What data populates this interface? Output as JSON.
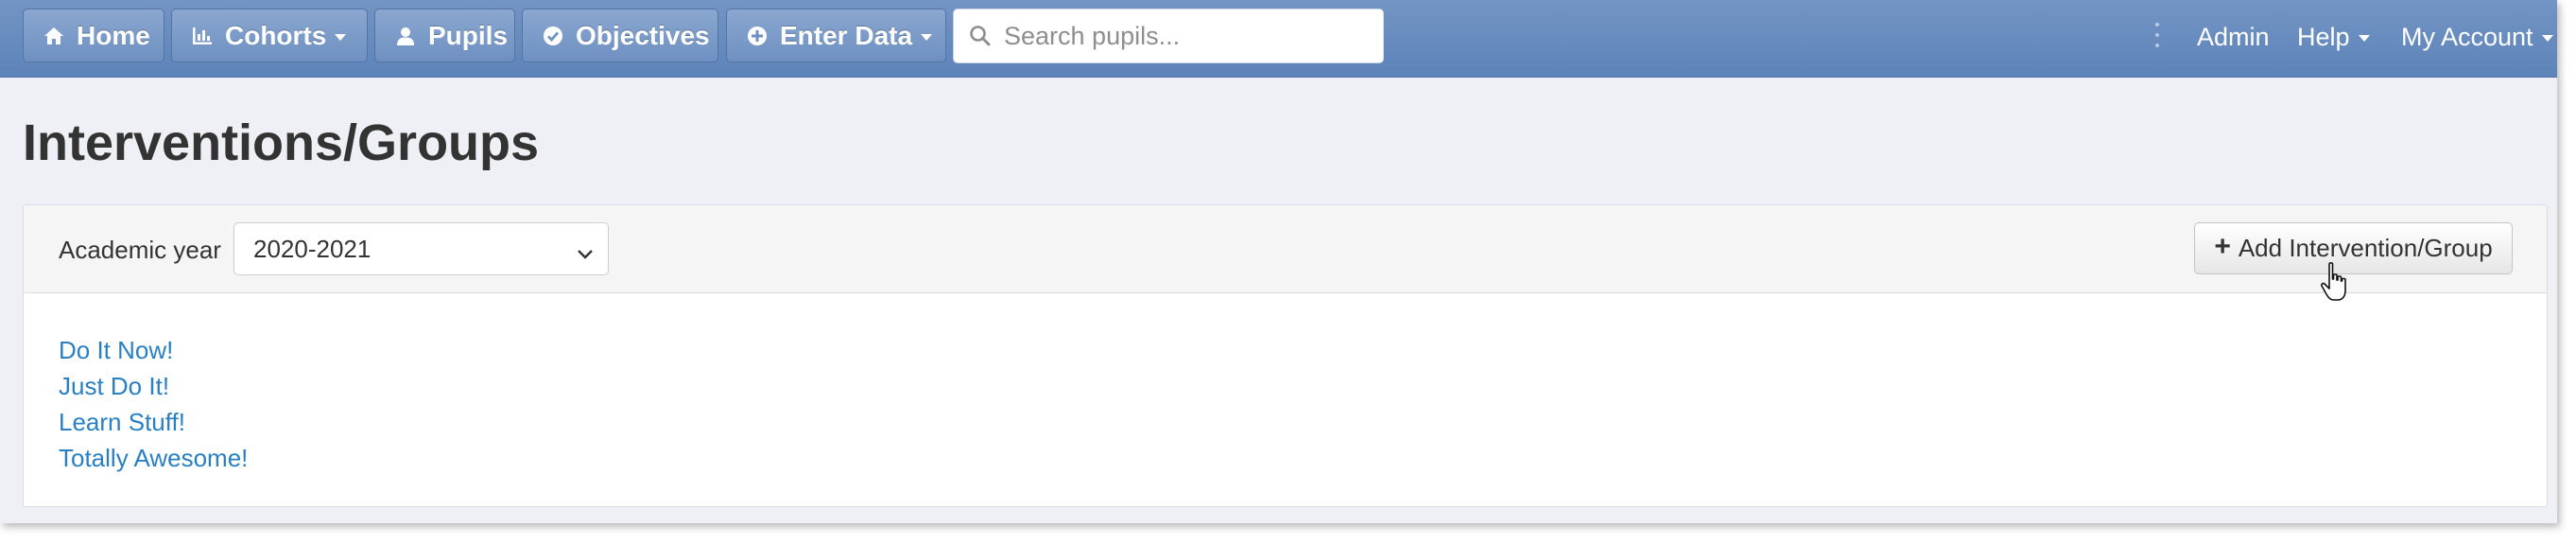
{
  "navbar": {
    "home": {
      "label": "Home",
      "icon": "home-icon"
    },
    "cohorts": {
      "label": "Cohorts",
      "icon": "bar-chart-icon"
    },
    "pupils": {
      "label": "Pupils",
      "icon": "user-icon"
    },
    "objectives": {
      "label": "Objectives",
      "icon": "check-circle-icon"
    },
    "enter_data": {
      "label": "Enter Data",
      "icon": "plus-circle-icon"
    },
    "search": {
      "placeholder": "Search pupils...",
      "value": "",
      "icon": "search-icon"
    },
    "admin": "Admin",
    "help": "Help",
    "my_account": "My Account"
  },
  "page": {
    "title": "Interventions/Groups"
  },
  "panel": {
    "year_label": "Academic year",
    "year_selected": "2020-2021",
    "add_button_label": "Add Intervention/Group",
    "groups": [
      "Do It Now!",
      "Just Do It!",
      "Learn Stuff!",
      "Totally Awesome!"
    ]
  },
  "colors": {
    "navbar": "#6a8dc0",
    "link": "#2a7fc2",
    "title": "#333333"
  }
}
